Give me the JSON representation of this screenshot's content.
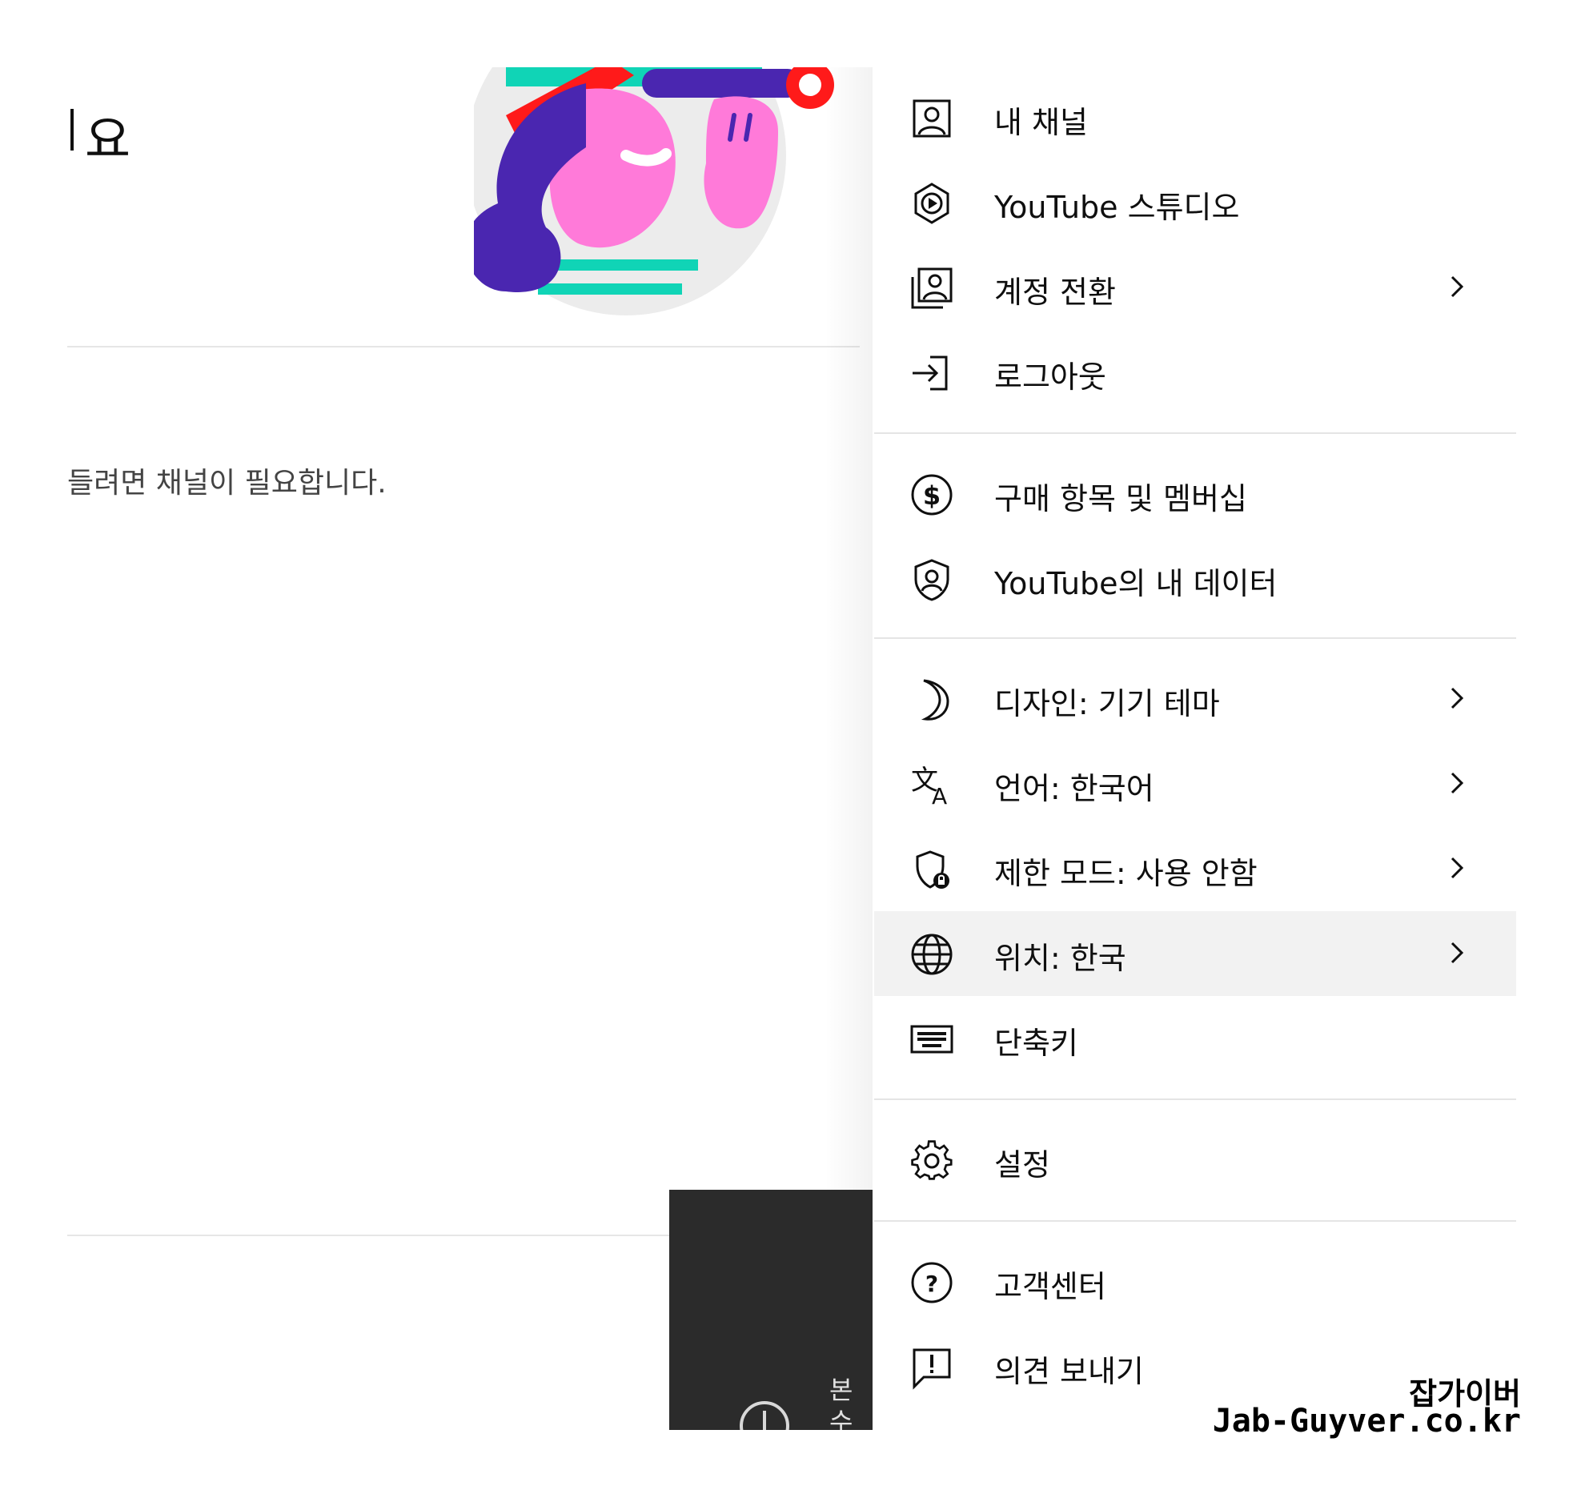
{
  "left": {
    "heading_fragment": "요",
    "channel_note": "들려면 채널이 필요합니다."
  },
  "toast": {
    "text": "본수"
  },
  "menu": {
    "items": [
      {
        "label": "내 채널",
        "icon": "account-box-icon",
        "has_submenu": false
      },
      {
        "label": "YouTube 스튜디오",
        "icon": "studio-icon",
        "has_submenu": false
      },
      {
        "label": "계정 전환",
        "icon": "switch-account-icon",
        "has_submenu": true
      },
      {
        "label": "로그아웃",
        "icon": "sign-out-icon",
        "has_submenu": false
      },
      {
        "label": "구매 항목 및 멤버십",
        "icon": "dollar-icon",
        "has_submenu": false
      },
      {
        "label": "YouTube의 내 데이터",
        "icon": "shield-person-icon",
        "has_submenu": false
      },
      {
        "label": "디자인: 기기 테마",
        "icon": "moon-icon",
        "has_submenu": true
      },
      {
        "label": "언어: 한국어",
        "icon": "translate-icon",
        "has_submenu": true
      },
      {
        "label": "제한 모드: 사용 안함",
        "icon": "restricted-shield-icon",
        "has_submenu": true
      },
      {
        "label": "위치: 한국",
        "icon": "globe-icon",
        "has_submenu": true,
        "highlighted": true
      },
      {
        "label": "단축키",
        "icon": "keyboard-icon",
        "has_submenu": false
      },
      {
        "label": "설정",
        "icon": "gear-icon",
        "has_submenu": false
      },
      {
        "label": "고객센터",
        "icon": "help-icon",
        "has_submenu": false
      },
      {
        "label": "의견 보내기",
        "icon": "feedback-icon",
        "has_submenu": false
      }
    ]
  },
  "watermark": {
    "line1": "잡가이버",
    "line2": "Jab-Guyver.co.kr"
  },
  "colors": {
    "highlight_row": "#f2f2f2",
    "divider": "#e5e5e5",
    "toast_bg": "#2b2b2b",
    "illustration_purple": "#4a26b0",
    "illustration_pink": "#ff7ad9",
    "illustration_teal": "#10d4b6",
    "illustration_red": "#ff1a1a"
  }
}
